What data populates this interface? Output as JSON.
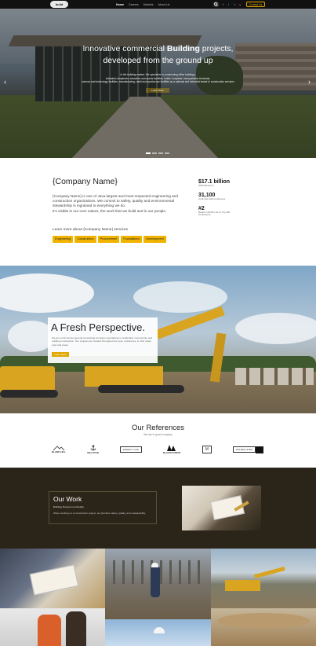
{
  "nav": {
    "logo": "build",
    "items": [
      "Home",
      "Careers",
      "Markets",
      "About Us"
    ],
    "social": [
      "f",
      "t",
      "in",
      "g"
    ],
    "contact": "Contact Us"
  },
  "hero": {
    "title_pre": "Innovative commercial ",
    "title_bold": "Building",
    "title_post": " projects, developed from the ground up",
    "sub1": "In the building market, We specialize in constructing office buildings,",
    "sub2": "industrial complexes, education and sports facilities, hotels, hospitals, transportation terminals,",
    "sub3": "science and technology facilities, manufacturing, retail and special-use facilities as a national and industrial leader in construction services",
    "button": "Learn More",
    "prev": "‹",
    "next": "›"
  },
  "about": {
    "title": "{Company Name}",
    "p1": "{Company Name} is one of Java largest and most respected engineering and construction organizations. We commit to safety, quality and environmental stewardship is ingrained in everything we do.",
    "p2": "It's visible in our core values, the work that we build and in our people.",
    "learn": "Learn more about {Company Name} services",
    "tags": [
      "Engineering",
      "Construction",
      "Procurement",
      "Foundations",
      "Development"
    ],
    "stats": [
      {
        "num": "$17.1 billion",
        "label": "2023 Revenue"
      },
      {
        "num": "31,100",
        "label": "Craft and staff employees"
      },
      {
        "num": "#2",
        "label": "Ranks in ENR's list of Top 400 Contractors"
      }
    ]
  },
  "fresh": {
    "title": "A Fresh Perspective.",
    "text": "We are a full service general contracting company specializing in residential, commercial, and building construction. Our projects are located throughout the year, residences, in both urban and rural areas.",
    "button": "Learn More"
  },
  "refs": {
    "title": "Our References",
    "sub": "We are in good company",
    "logos": [
      "BLANK HILL",
      "SEA STAR",
      "ENERGY CAR",
      "BLACKFOREST",
      "M",
      "DOUBLE STEP"
    ]
  },
  "work": {
    "title": "Our Work",
    "tagline": "Building Dreams into Reality",
    "text": "When working on a construction project, we prioritize safety, quality, and sustainability."
  },
  "colors": {
    "accent": "#e0a800",
    "dark": "#2b2519",
    "nav": "#111111"
  }
}
